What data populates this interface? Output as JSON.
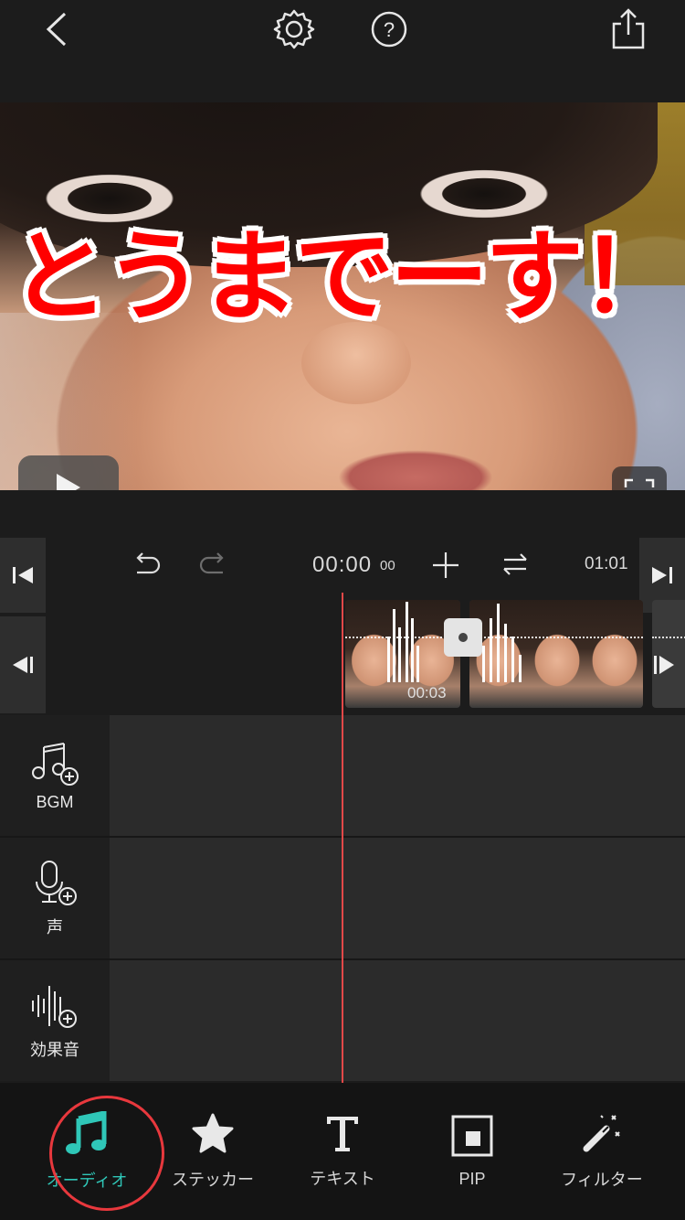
{
  "header": {
    "back_icon": "chevron-left-icon",
    "settings_icon": "gear-icon",
    "help_icon": "question-circle-icon",
    "share_icon": "share-icon"
  },
  "preview": {
    "caption_text": "とうまでーす！",
    "caption_color": "#ff0000",
    "play_icon": "play-icon",
    "fullscreen_icon": "fullscreen-icon"
  },
  "timeline": {
    "current_time": "00:00",
    "current_time_frames": "00",
    "total_time": "01:01",
    "clip_duration": "00:03",
    "playhead_color": "#e24848"
  },
  "audio_rows": {
    "bgm_label": "BGM",
    "voice_label": "声",
    "sfx_label": "効果音"
  },
  "tabs": [
    {
      "label": "オーディオ",
      "icon": "music-note-icon",
      "active": true
    },
    {
      "label": "ステッカー",
      "icon": "star-icon",
      "active": false
    },
    {
      "label": "テキスト",
      "icon": "text-icon",
      "active": false
    },
    {
      "label": "PIP",
      "icon": "pip-icon",
      "active": false
    },
    {
      "label": "フィルター",
      "icon": "magic-wand-icon",
      "active": false
    }
  ],
  "colors": {
    "accent": "#2fc7b8",
    "highlight_circle": "#e8383d",
    "background": "#1c1c1c"
  }
}
